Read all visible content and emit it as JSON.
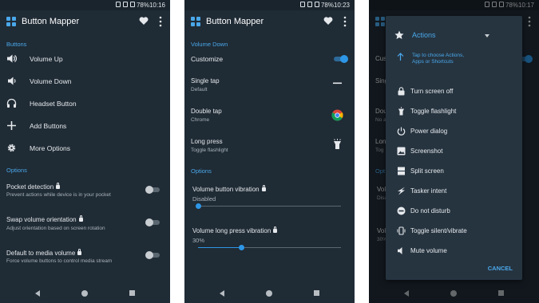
{
  "colors": {
    "background": "#1f2b35",
    "accent": "#4aa8ea",
    "text": "#e6e9ec",
    "subtext": "#a9b3bb"
  },
  "screen1": {
    "status": {
      "battery": "78%",
      "time": "10:16"
    },
    "app_title": "Button Mapper",
    "buttons_header": "Buttons",
    "buttons": [
      {
        "label": "Volume Up",
        "icon": "volume-up-icon"
      },
      {
        "label": "Volume Down",
        "icon": "volume-down-icon"
      },
      {
        "label": "Headset Button",
        "icon": "headset-icon"
      },
      {
        "label": "Add Buttons",
        "icon": "plus-icon"
      },
      {
        "label": "More Options",
        "icon": "gear-icon"
      }
    ],
    "options_header": "Options",
    "options": [
      {
        "title": "Pocket detection",
        "subtitle": "Prevent actions while device is in your pocket",
        "enabled": false
      },
      {
        "title": "Swap volume orientation",
        "subtitle": "Adjust orientation based on screen rotation",
        "enabled": false
      },
      {
        "title": "Default to media volume",
        "subtitle": "Force volume buttons to control media stream",
        "enabled": false
      }
    ]
  },
  "screen2": {
    "status": {
      "battery": "78%",
      "time": "10:23"
    },
    "app_title": "Button Mapper",
    "section_header": "Volume Down",
    "customize": {
      "label": "Customize",
      "enabled": true
    },
    "actions": [
      {
        "title": "Single tap",
        "subtitle": "Default",
        "icon": "dash-icon"
      },
      {
        "title": "Double tap",
        "subtitle": "Chrome",
        "icon": "chrome-icon"
      },
      {
        "title": "Long press",
        "subtitle": "Toggle flashlight",
        "icon": "flashlight-icon"
      }
    ],
    "options_header": "Options",
    "vibration": {
      "title": "Volume button vibration",
      "value_text": "Disabled",
      "level": 0
    },
    "long_vibration": {
      "title": "Volume long press vibration",
      "value_text": "30%",
      "level": 0.3
    }
  },
  "screen3": {
    "status": {
      "battery": "78%",
      "time": "10:17"
    },
    "dialog": {
      "dropdown_label": "Actions",
      "hint": "Tap to choose Actions, Apps or Shortcuts",
      "items": [
        {
          "label": "Turn screen off",
          "icon": "lock-icon"
        },
        {
          "label": "Toggle flashlight",
          "icon": "flashlight-icon"
        },
        {
          "label": "Power dialog",
          "icon": "power-icon"
        },
        {
          "label": "Screenshot",
          "icon": "image-icon"
        },
        {
          "label": "Split screen",
          "icon": "split-screen-icon"
        },
        {
          "label": "Tasker intent",
          "icon": "bolt-icon"
        },
        {
          "label": "Do not disturb",
          "icon": "do-not-disturb-icon"
        },
        {
          "label": "Toggle silent/vibrate",
          "icon": "vibrate-icon"
        },
        {
          "label": "Mute volume",
          "icon": "mute-icon"
        }
      ],
      "cancel_label": "CANCEL"
    },
    "background_fragments": [
      "Cust",
      "Sing",
      "Doub",
      "No a",
      "Lon",
      "Tog",
      "Opt",
      "Volu",
      "Disa",
      "Volu",
      "30%"
    ]
  }
}
